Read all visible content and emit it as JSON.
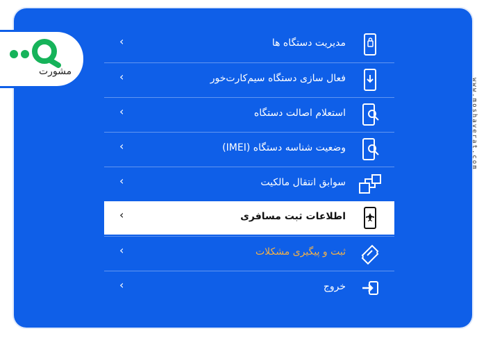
{
  "menu": {
    "items": [
      {
        "label": "مدیریت دستگاه ها",
        "icon": "phone-lock-icon"
      },
      {
        "label": "فعال سازی دستگاه سیم‌کارت‌خور",
        "icon": "phone-download-icon"
      },
      {
        "label": "استعلام اصالت دستگاه",
        "icon": "phone-search-icon"
      },
      {
        "label": "وضعیت شناسه دستگاه (IMEI)",
        "icon": "phone-search-icon"
      },
      {
        "label": "سوابق انتقال مالکیت",
        "icon": "ownership-transfer-icon"
      },
      {
        "label": "اطلاعات ثبت مسافری",
        "icon": "phone-airplane-icon",
        "active": true
      },
      {
        "label": "ثبت و پیگیری مشکلات",
        "icon": "ticket-icon",
        "muted": true
      },
      {
        "label": "خروج",
        "icon": "logout-icon"
      }
    ],
    "chevron": "‹"
  },
  "brand": {
    "logo_text": "مشورت"
  },
  "site": {
    "url": "www.moshaverat.com"
  },
  "colors": {
    "accent": "#0f5fe8",
    "active_bg": "#ffffff",
    "muted_text": "#f0b04a"
  }
}
